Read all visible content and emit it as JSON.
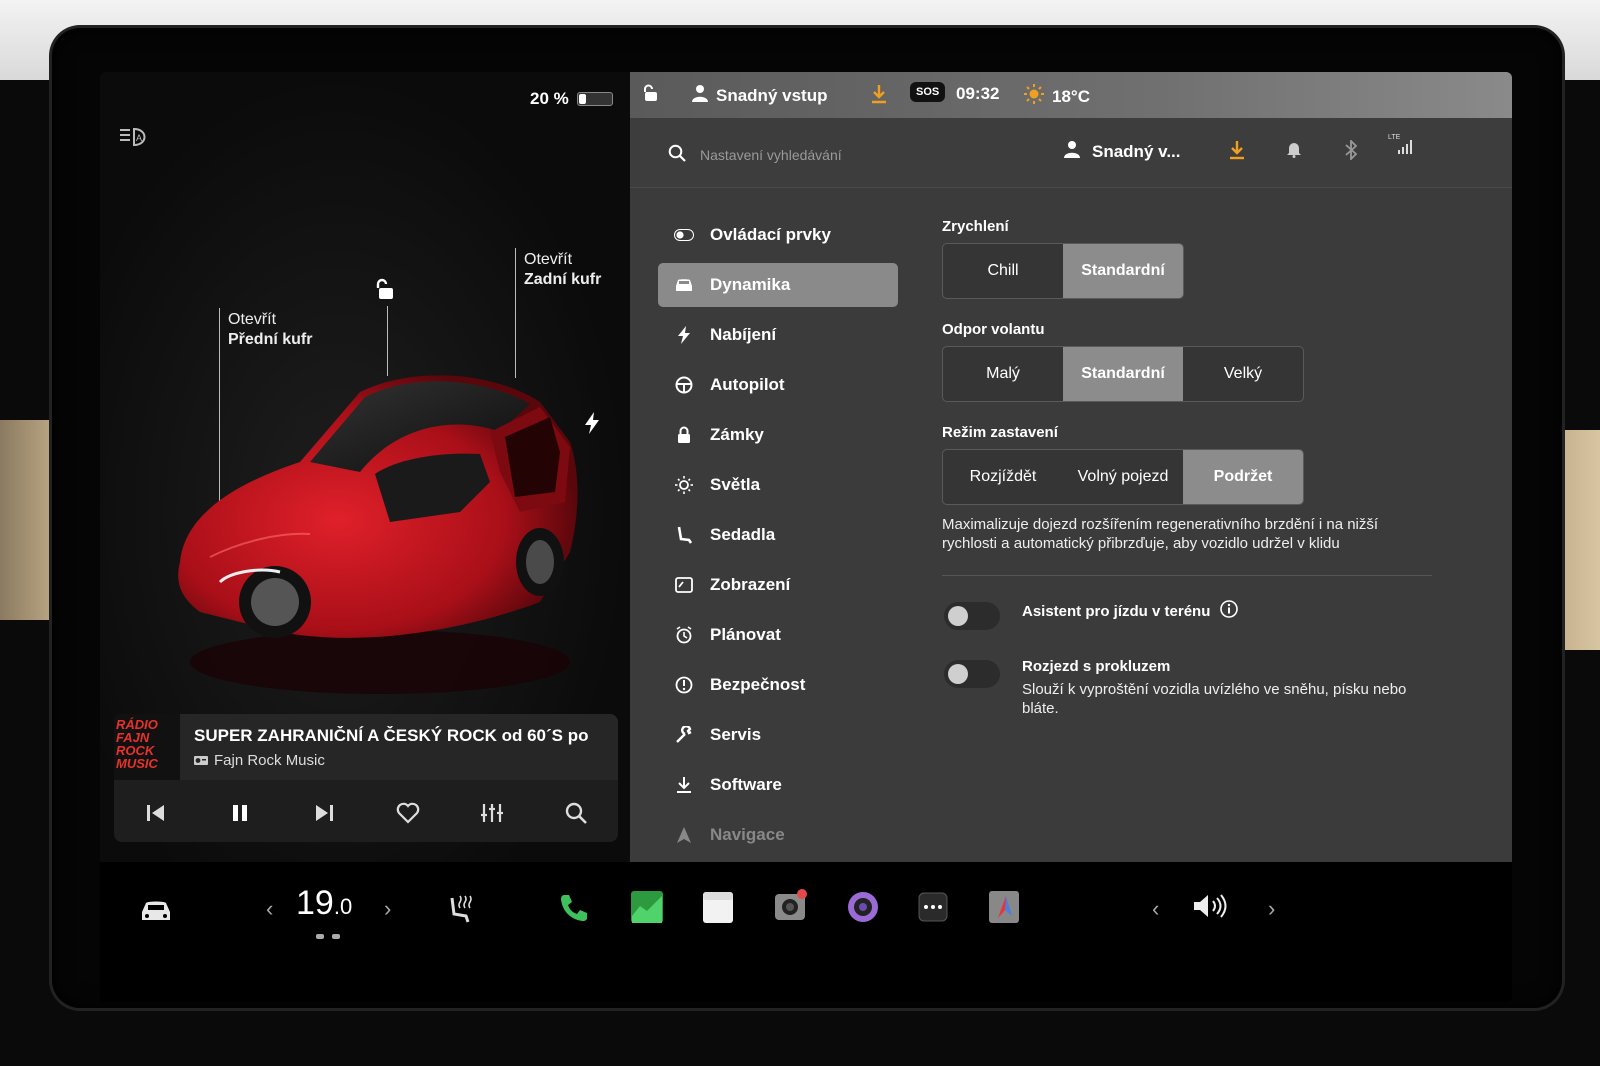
{
  "status": {
    "battery_percent": "20 %",
    "battery_level": 0.2,
    "profile_name": "Snadný vstup",
    "sos": "SOS",
    "time": "09:32",
    "temperature": "18°C"
  },
  "car_panel": {
    "front_trunk": {
      "line1": "Otevřít",
      "line2": "Přední kufr"
    },
    "rear_trunk": {
      "line1": "Otevřít",
      "line2": "Zadní kufr"
    }
  },
  "media": {
    "album_art_text": "RÁDIO FAJN ROCK MUSIC",
    "song": "SUPER ZAHRANIČNÍ A ČESKÝ ROCK od 60´S po",
    "station": "Fajn Rock Music"
  },
  "settings_header": {
    "search_placeholder": "Nastavení vyhledávání",
    "profile_short": "Snadný v...",
    "network_label": "LTE"
  },
  "nav": [
    {
      "label": "Ovládací prvky",
      "icon": "toggle-icon"
    },
    {
      "label": "Dynamika",
      "icon": "car-icon",
      "active": true
    },
    {
      "label": "Nabíjení",
      "icon": "bolt-icon"
    },
    {
      "label": "Autopilot",
      "icon": "steering-wheel-icon"
    },
    {
      "label": "Zámky",
      "icon": "lock-icon"
    },
    {
      "label": "Světla",
      "icon": "sun-icon"
    },
    {
      "label": "Sedadla",
      "icon": "seat-icon"
    },
    {
      "label": "Zobrazení",
      "icon": "display-icon"
    },
    {
      "label": "Plánovat",
      "icon": "alarm-clock-icon"
    },
    {
      "label": "Bezpečnost",
      "icon": "alert-circle-icon"
    },
    {
      "label": "Servis",
      "icon": "wrench-icon"
    },
    {
      "label": "Software",
      "icon": "download-icon"
    },
    {
      "label": "Navigace",
      "icon": "navigation-icon"
    }
  ],
  "dynamics": {
    "acceleration": {
      "label": "Zrychlení",
      "options": [
        "Chill",
        "Standardní"
      ],
      "selected": "Standardní"
    },
    "steering": {
      "label": "Odpor volantu",
      "options": [
        "Malý",
        "Standardní",
        "Velký"
      ],
      "selected": "Standardní"
    },
    "stopping": {
      "label": "Režim zastavení",
      "options": [
        "Rozjíždět",
        "Volný pojezd",
        "Podržet"
      ],
      "selected": "Podržet"
    },
    "stopping_description": "Maximalizuje dojezd rozšířením regenerativního brzdění i na nižší rychlosti a automatický přibrzďuje, aby vozidlo udržel v klidu",
    "offroad_assist": {
      "label": "Asistent pro jízdu v terénu",
      "enabled": false
    },
    "slip_start": {
      "label": "Rozjezd s prokluzem",
      "description": "Slouží k vyproštění vozidla uvízlého ve sněhu, písku nebo bláte.",
      "enabled": false
    }
  },
  "dock": {
    "cabin_temp_int": "19",
    "cabin_temp_dec": ".0"
  },
  "colors": {
    "accent_orange": "#f0a020",
    "car_red": "#c0141e",
    "selected_segment": "#8c8c8c"
  }
}
